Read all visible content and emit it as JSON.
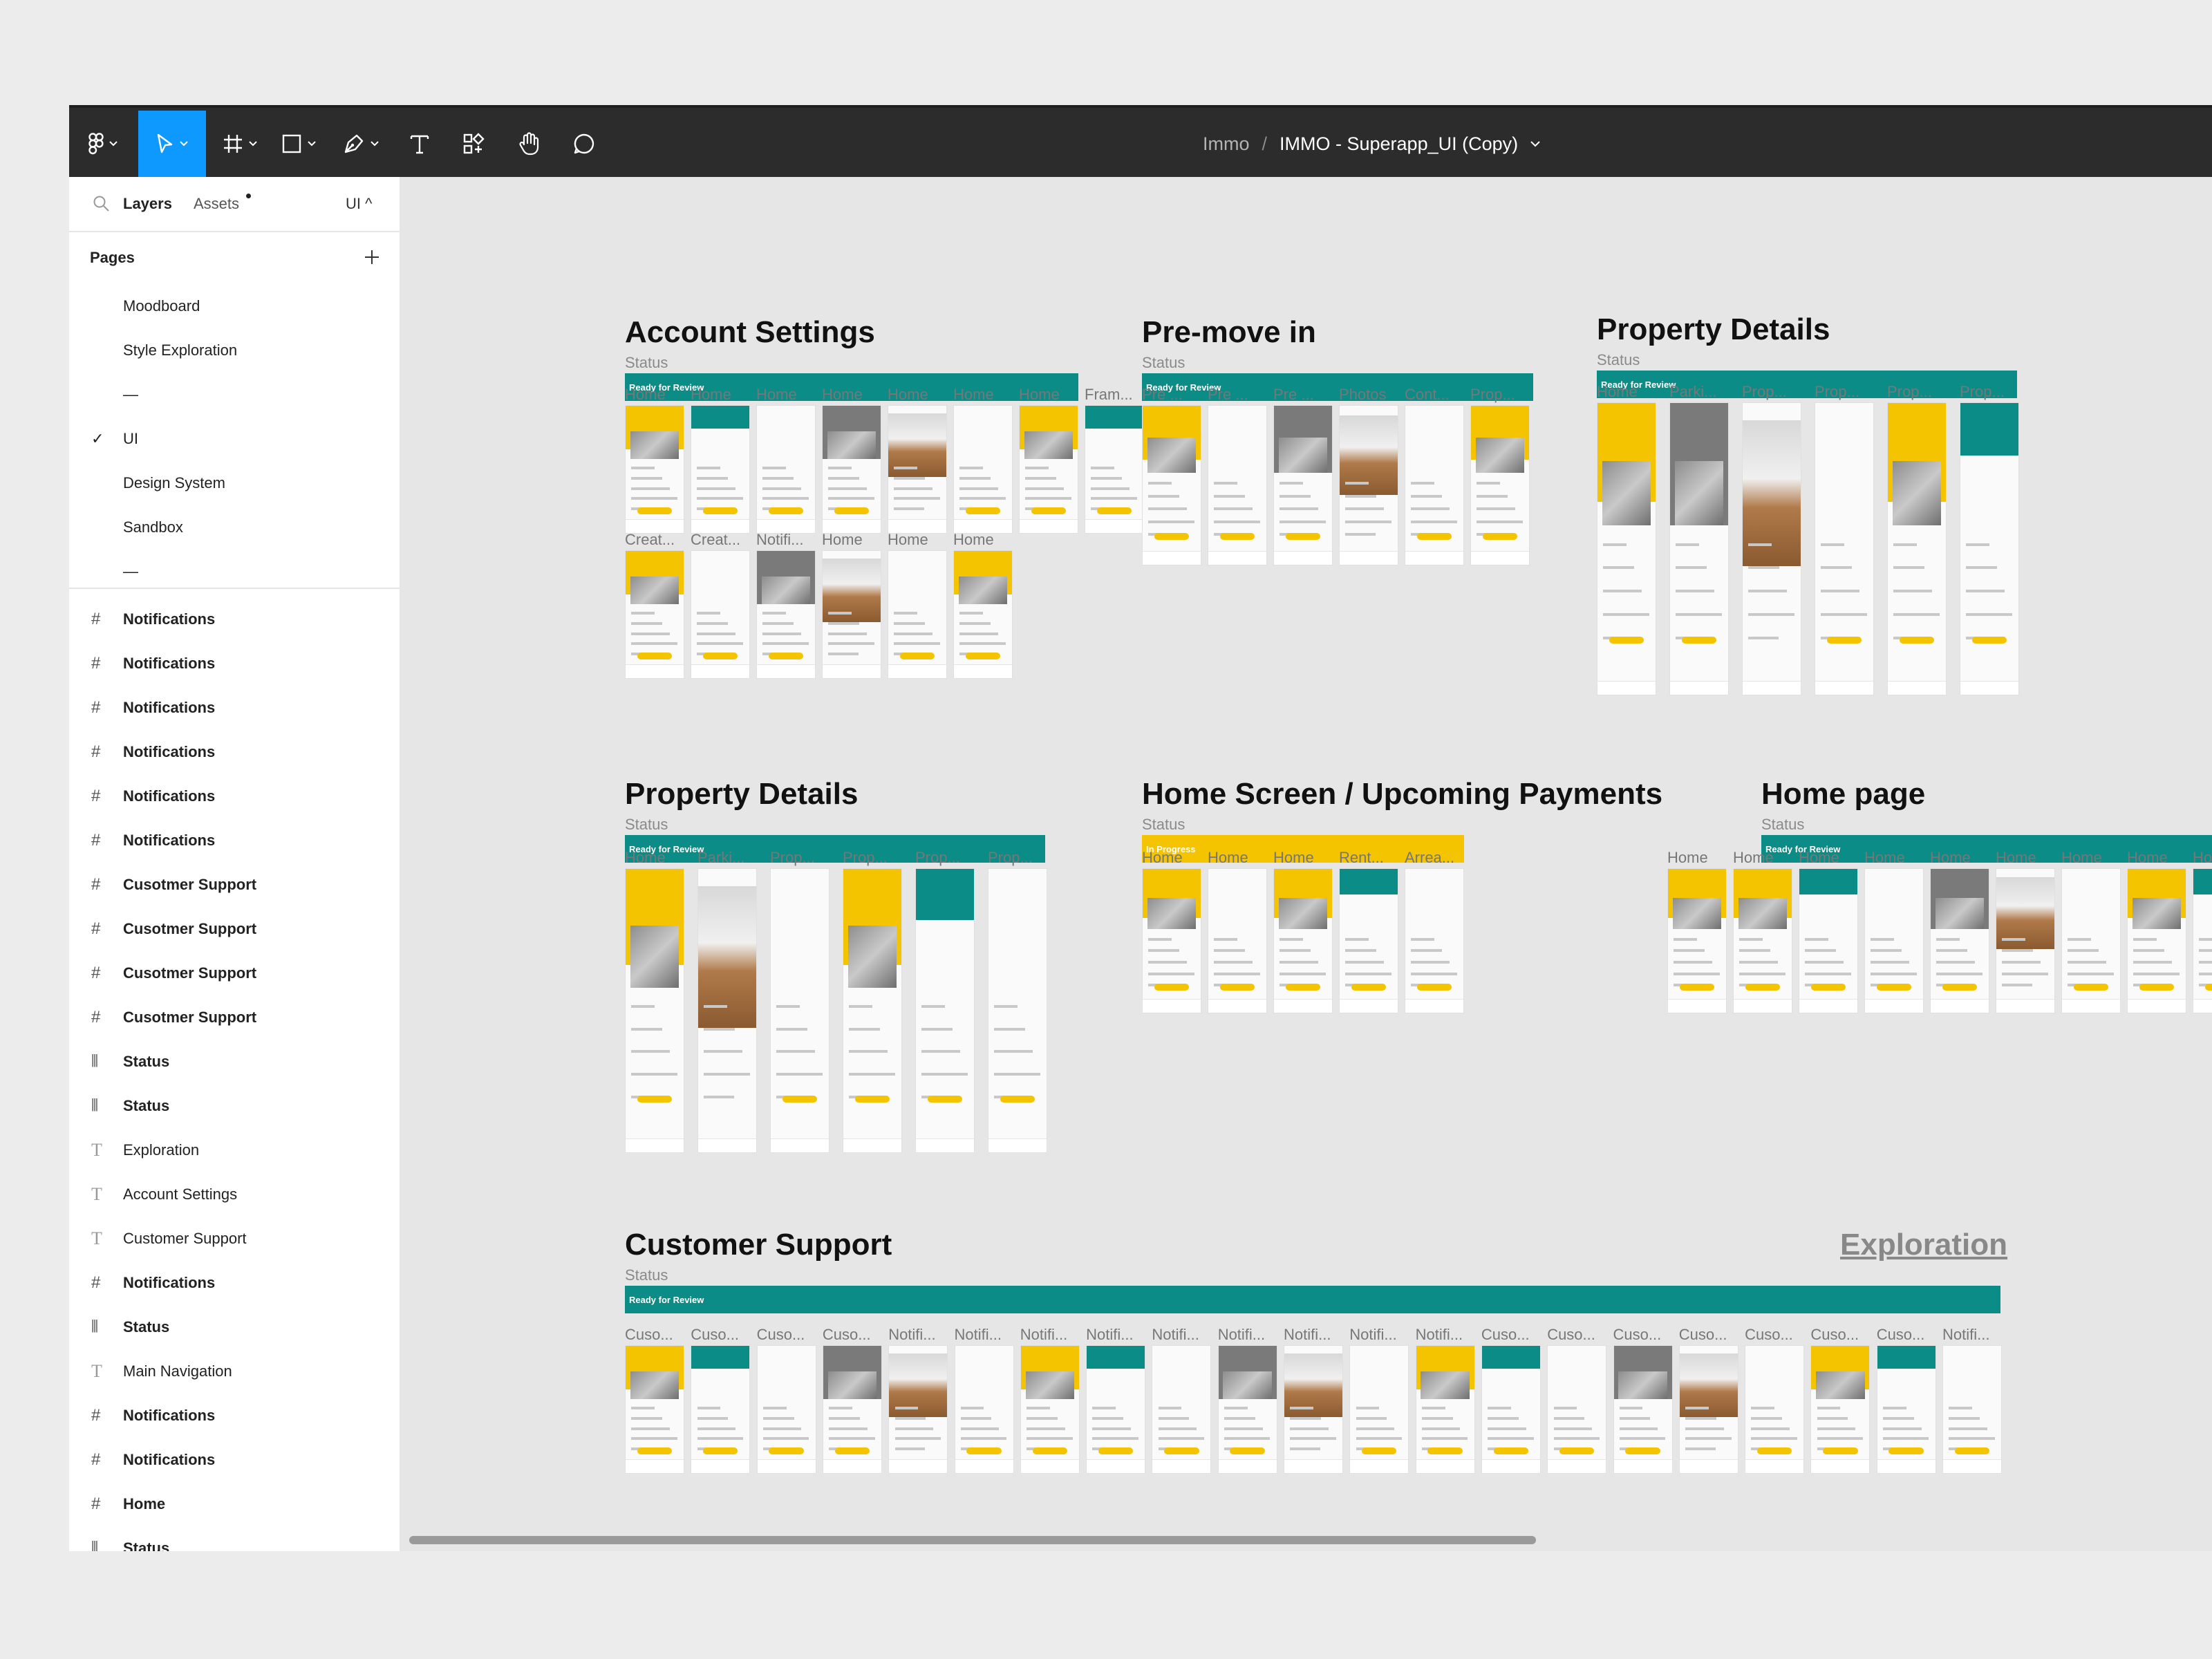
{
  "breadcrumb": {
    "project": "Immo",
    "separator": "/",
    "file": "IMMO - Superapp_UI (Copy)"
  },
  "toolbar": {
    "tools": [
      "main-menu",
      "move",
      "frame",
      "shape",
      "pen",
      "text",
      "components",
      "hand",
      "comment"
    ],
    "active": "move",
    "accent": "#0d99ff"
  },
  "sidebar": {
    "tabs": {
      "layers": "Layers",
      "assets": "Assets",
      "page_selector": "UI ^"
    },
    "pages_header": "Pages",
    "pages": [
      {
        "label": "Moodboard",
        "checked": ""
      },
      {
        "label": "Style Exploration",
        "checked": ""
      },
      {
        "label": "—",
        "checked": ""
      },
      {
        "label": "UI",
        "checked": "✓"
      },
      {
        "label": "Design System",
        "checked": ""
      },
      {
        "label": "Sandbox",
        "checked": ""
      },
      {
        "label": "—",
        "checked": ""
      }
    ],
    "layers": [
      {
        "type": "frame",
        "icon": "#",
        "label": "Notifications"
      },
      {
        "type": "frame",
        "icon": "#",
        "label": "Notifications"
      },
      {
        "type": "frame",
        "icon": "#",
        "label": "Notifications"
      },
      {
        "type": "frame",
        "icon": "#",
        "label": "Notifications"
      },
      {
        "type": "frame",
        "icon": "#",
        "label": "Notifications"
      },
      {
        "type": "frame",
        "icon": "#",
        "label": "Notifications"
      },
      {
        "type": "frame",
        "icon": "#",
        "label": "Cusotmer Support"
      },
      {
        "type": "frame",
        "icon": "#",
        "label": "Cusotmer Support"
      },
      {
        "type": "frame",
        "icon": "#",
        "label": "Cusotmer Support"
      },
      {
        "type": "frame",
        "icon": "#",
        "label": "Cusotmer Support"
      },
      {
        "type": "status",
        "icon": "⫴",
        "label": "Status"
      },
      {
        "type": "status",
        "icon": "⫴",
        "label": "Status"
      },
      {
        "type": "text",
        "icon": "T",
        "label": "Exploration"
      },
      {
        "type": "text",
        "icon": "T",
        "label": "Account Settings"
      },
      {
        "type": "text",
        "icon": "T",
        "label": "Customer Support"
      },
      {
        "type": "frame",
        "icon": "#",
        "label": "Notifications"
      },
      {
        "type": "status",
        "icon": "⫴",
        "label": "Status"
      },
      {
        "type": "text",
        "icon": "T",
        "label": "Main Navigation"
      },
      {
        "type": "frame",
        "icon": "#",
        "label": "Notifications"
      },
      {
        "type": "frame",
        "icon": "#",
        "label": "Notifications"
      },
      {
        "type": "frame",
        "icon": "#",
        "label": "Home"
      },
      {
        "type": "status",
        "icon": "⫴",
        "label": "Status"
      }
    ]
  },
  "canvas": {
    "sections": [
      {
        "title": "Account Settings",
        "status_label": "Status",
        "status": "Ready for Review",
        "status_color": "#0b8c87",
        "frames_row1": [
          "Home",
          "Home",
          "Home",
          "Home",
          "Home",
          "Home",
          "Home",
          "Fram..."
        ],
        "frames_row2": [
          "Creat...",
          "Creat...",
          "Notifi...",
          "Home",
          "Home",
          "Home"
        ]
      },
      {
        "title": "Pre-move in",
        "status_label": "Status",
        "status": "Ready for Review",
        "status_color": "#0b8c87",
        "frames": [
          "Pre ...",
          "Pre ...",
          "Pre ...",
          "Photos",
          "Cont...",
          "Prop..."
        ]
      },
      {
        "title": "Property Details",
        "status_label": "Status",
        "status": "Ready for Review",
        "status_color": "#0b8c87",
        "frames": [
          "Home",
          "Parki...",
          "Prop...",
          "Prop...",
          "Prop...",
          "Prop..."
        ]
      },
      {
        "title": "Property Details",
        "status_label": "Status",
        "status": "Ready for Review",
        "status_color": "#0b8c87",
        "frames": [
          "Home",
          "Parki...",
          "Prop...",
          "Prop...",
          "Prop...",
          "Prop..."
        ]
      },
      {
        "title": "Home Screen / Upcoming Payments",
        "status_label": "Status",
        "status": "In Progress",
        "status_color": "#f5c400",
        "frames": [
          "Home",
          "Home",
          "Home",
          "Rent...",
          "Arrea..."
        ]
      },
      {
        "title": "Home page",
        "status_label": "Status",
        "status": "Ready for Review",
        "status_color": "#0b8c87",
        "frames": [
          "Home",
          "Home",
          "Home",
          "Home",
          "Home",
          "Home",
          "Home",
          "Home",
          "Home"
        ]
      },
      {
        "title": "Customer Support",
        "status_label": "Status",
        "status": "Ready for Review",
        "status_color": "#0b8c87",
        "frames": [
          "Cuso...",
          "Cuso...",
          "Cuso...",
          "Cuso...",
          "Notifi...",
          "Notifi...",
          "Notifi...",
          "Notifi...",
          "Notifi...",
          "Notifi...",
          "Notifi...",
          "Notifi...",
          "Notifi...",
          "Cuso...",
          "Cuso...",
          "Cuso...",
          "Cuso...",
          "Cuso...",
          "Cuso...",
          "Cuso...",
          "Notifi..."
        ]
      }
    ],
    "exploration_link": "Exploration"
  }
}
